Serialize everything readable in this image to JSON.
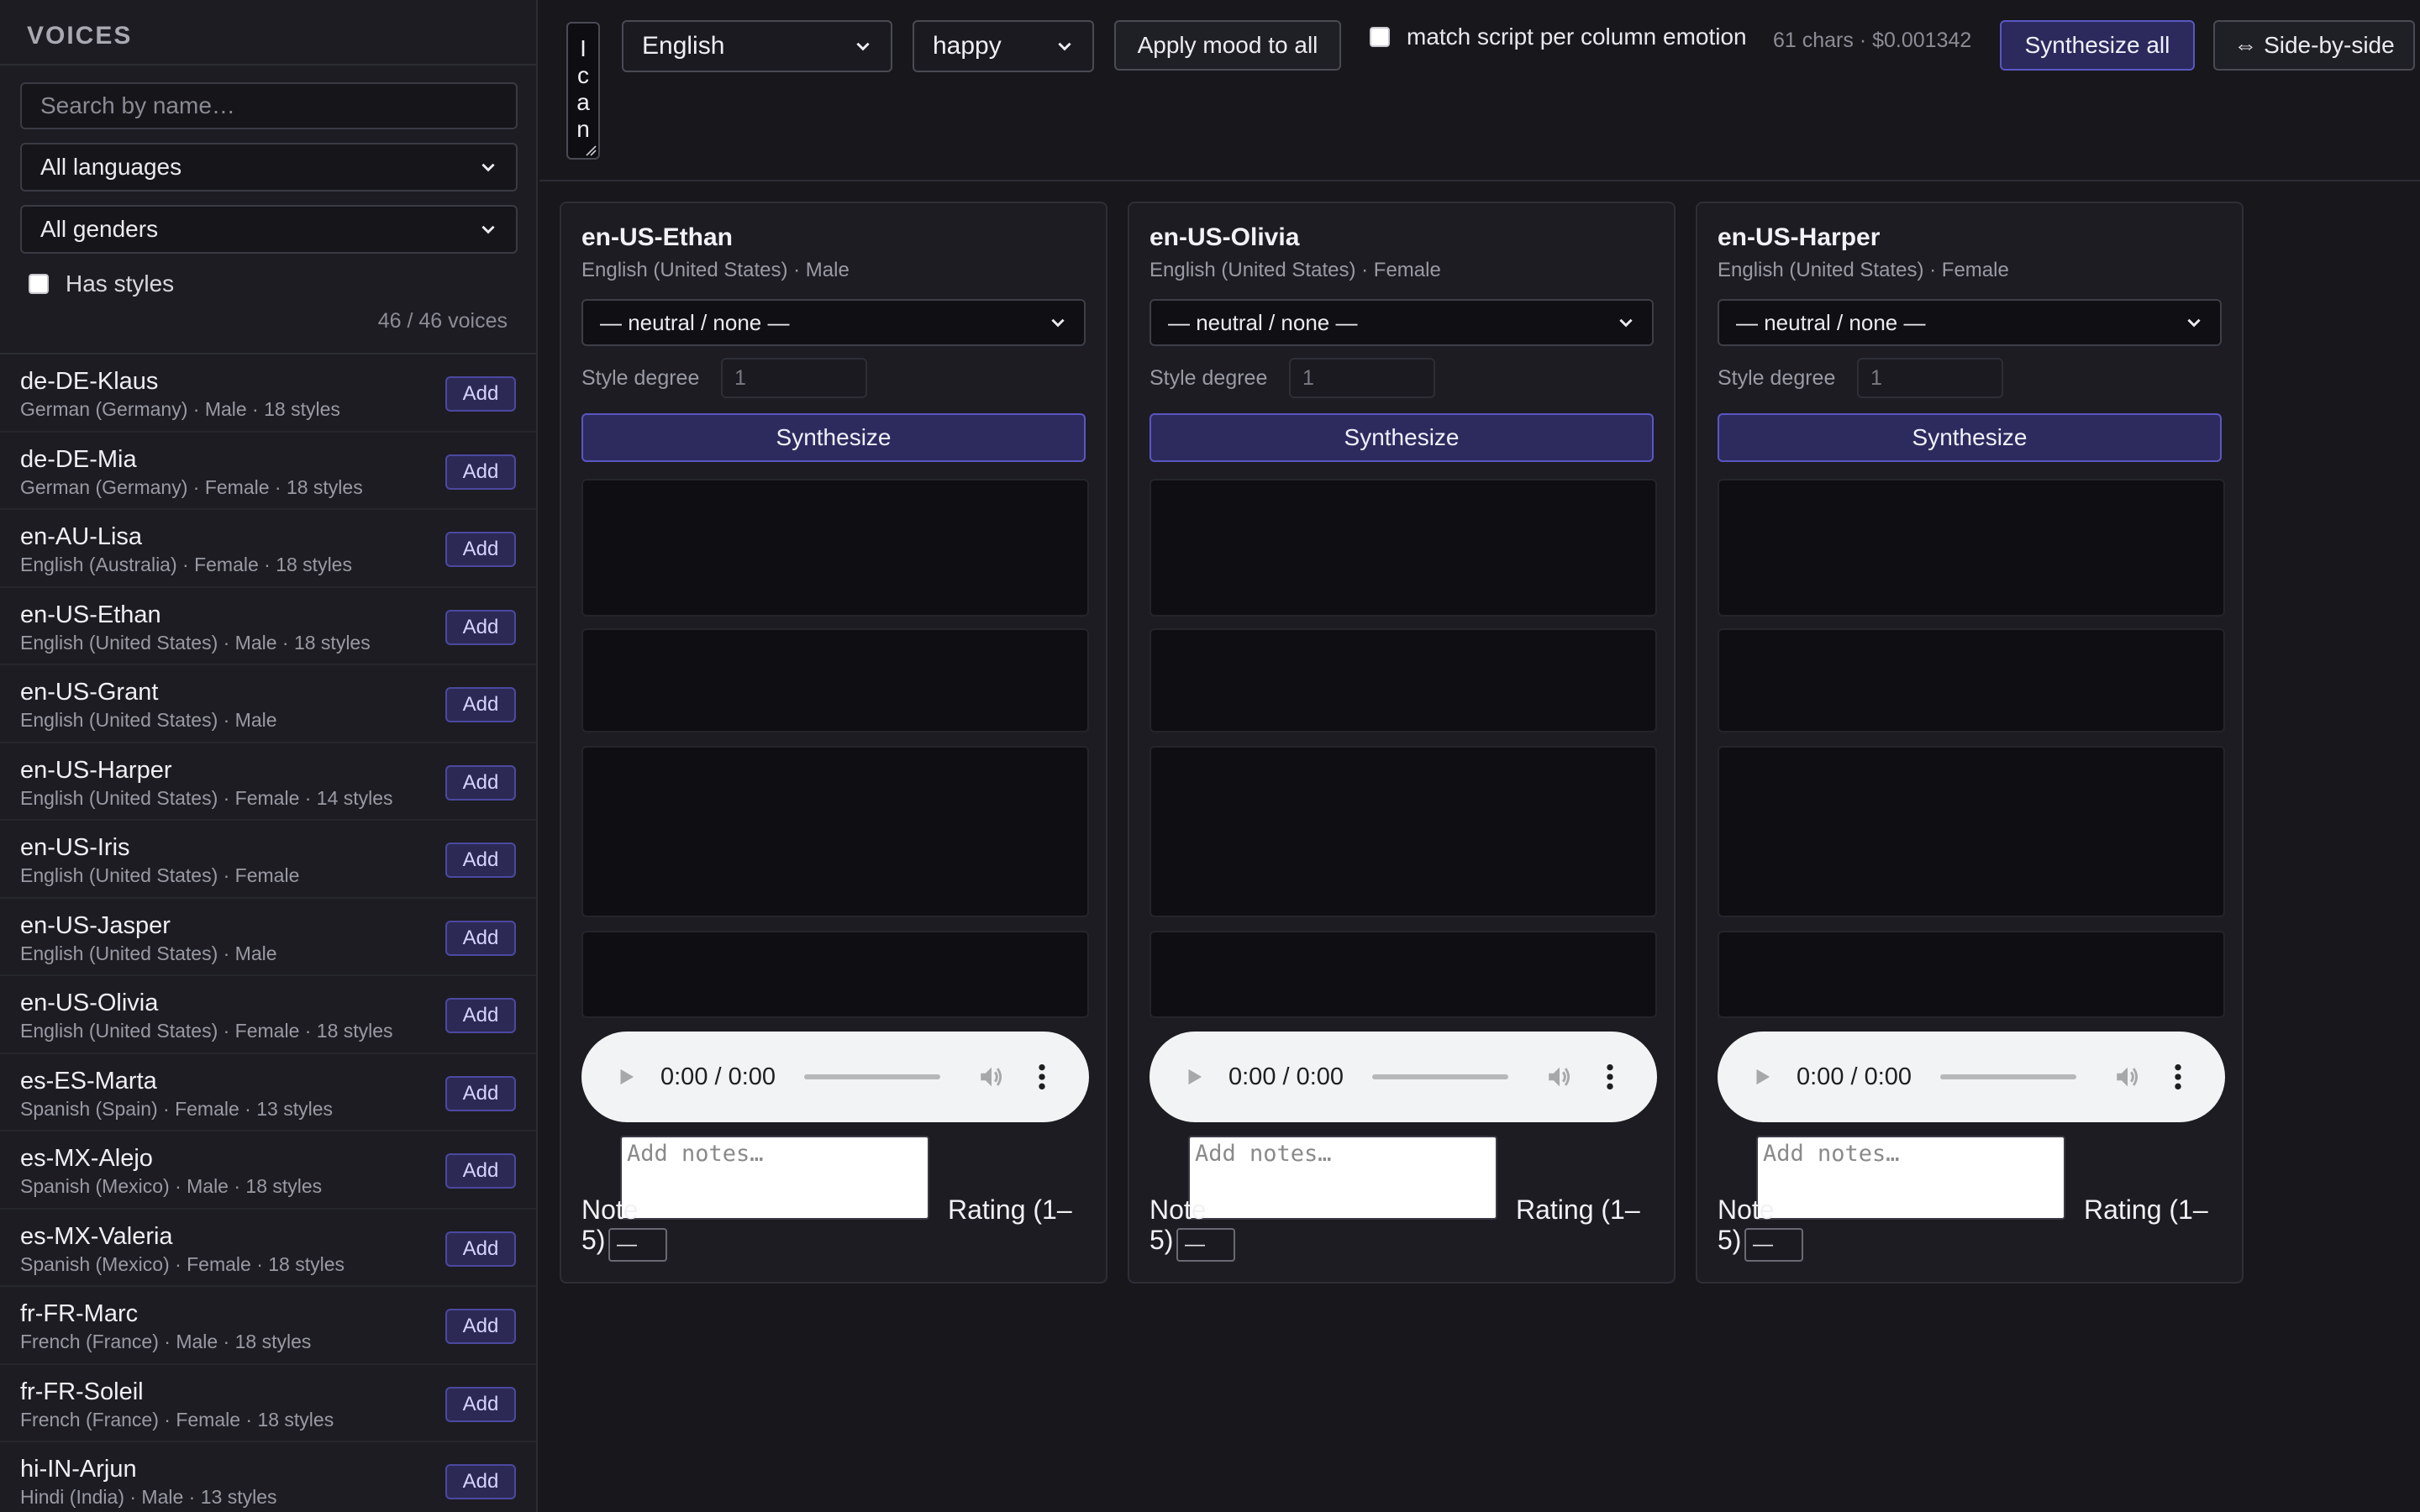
{
  "sidebar": {
    "title": "VOICES",
    "search_placeholder": "Search by name…",
    "language_filter": "All languages",
    "gender_filter": "All genders",
    "has_styles_label": "Has styles",
    "count_text": "46 / 46 voices",
    "add_label": "Add",
    "voices": [
      {
        "name": "de-DE-Klaus",
        "meta": "German (Germany) · Male · 18 styles"
      },
      {
        "name": "de-DE-Mia",
        "meta": "German (Germany) · Female · 18 styles"
      },
      {
        "name": "en-AU-Lisa",
        "meta": "English (Australia) · Female · 18 styles"
      },
      {
        "name": "en-US-Ethan",
        "meta": "English (United States) · Male · 18 styles"
      },
      {
        "name": "en-US-Grant",
        "meta": "English (United States) · Male"
      },
      {
        "name": "en-US-Harper",
        "meta": "English (United States) · Female · 14 styles"
      },
      {
        "name": "en-US-Iris",
        "meta": "English (United States) · Female"
      },
      {
        "name": "en-US-Jasper",
        "meta": "English (United States) · Male"
      },
      {
        "name": "en-US-Olivia",
        "meta": "English (United States) · Female · 18 styles"
      },
      {
        "name": "es-ES-Marta",
        "meta": "Spanish (Spain) · Female · 13 styles"
      },
      {
        "name": "es-MX-Alejo",
        "meta": "Spanish (Mexico) · Male · 18 styles"
      },
      {
        "name": "es-MX-Valeria",
        "meta": "Spanish (Mexico) · Female · 18 styles"
      },
      {
        "name": "fr-FR-Marc",
        "meta": "French (France) · Male · 18 styles"
      },
      {
        "name": "fr-FR-Soleil",
        "meta": "French (France) · Female · 18 styles"
      },
      {
        "name": "hi-IN-Arjun",
        "meta": "Hindi (India) · Male · 13 styles"
      }
    ]
  },
  "toolbar": {
    "script_visible_chars": [
      "I",
      "c",
      "a",
      "n"
    ],
    "language_value": "English",
    "mood_value": "happy",
    "apply_mood_label": "Apply mood to all",
    "match_script_label": "match script per column emotion",
    "meta_text": "61 chars · $0.001342",
    "synthesize_all_label": "Synthesize all",
    "side_by_side_label": "⇔ Side-by-side"
  },
  "columns": [
    {
      "name": "en-US-Ethan",
      "meta": "English (United States) · Male",
      "style_value": "— neutral / none —",
      "degree_label": "Style degree",
      "degree_placeholder": "1",
      "synthesize_label": "Synthesize",
      "time": "0:00 / 0:00",
      "notes_placeholder": "Add notes…",
      "notes_label": "Note",
      "rating_label": "Rating (1–",
      "rating_label_2": "5)",
      "rating_value": "—"
    },
    {
      "name": "en-US-Olivia",
      "meta": "English (United States) · Female",
      "style_value": "— neutral / none —",
      "degree_label": "Style degree",
      "degree_placeholder": "1",
      "synthesize_label": "Synthesize",
      "time": "0:00 / 0:00",
      "notes_placeholder": "Add notes…",
      "notes_label": "Note",
      "rating_label": "Rating (1–",
      "rating_label_2": "5)",
      "rating_value": "—"
    },
    {
      "name": "en-US-Harper",
      "meta": "English (United States) · Female",
      "style_value": "— neutral / none —",
      "degree_label": "Style degree",
      "degree_placeholder": "1",
      "synthesize_label": "Synthesize",
      "time": "0:00 / 0:00",
      "notes_placeholder": "Add notes…",
      "notes_label": "Note",
      "rating_label": "Rating (1–",
      "rating_label_2": "5)",
      "rating_value": "—"
    }
  ],
  "colors": {
    "background": "#17171c",
    "accent": "#5a56c2",
    "accent_fill": "#2d2b5e"
  }
}
